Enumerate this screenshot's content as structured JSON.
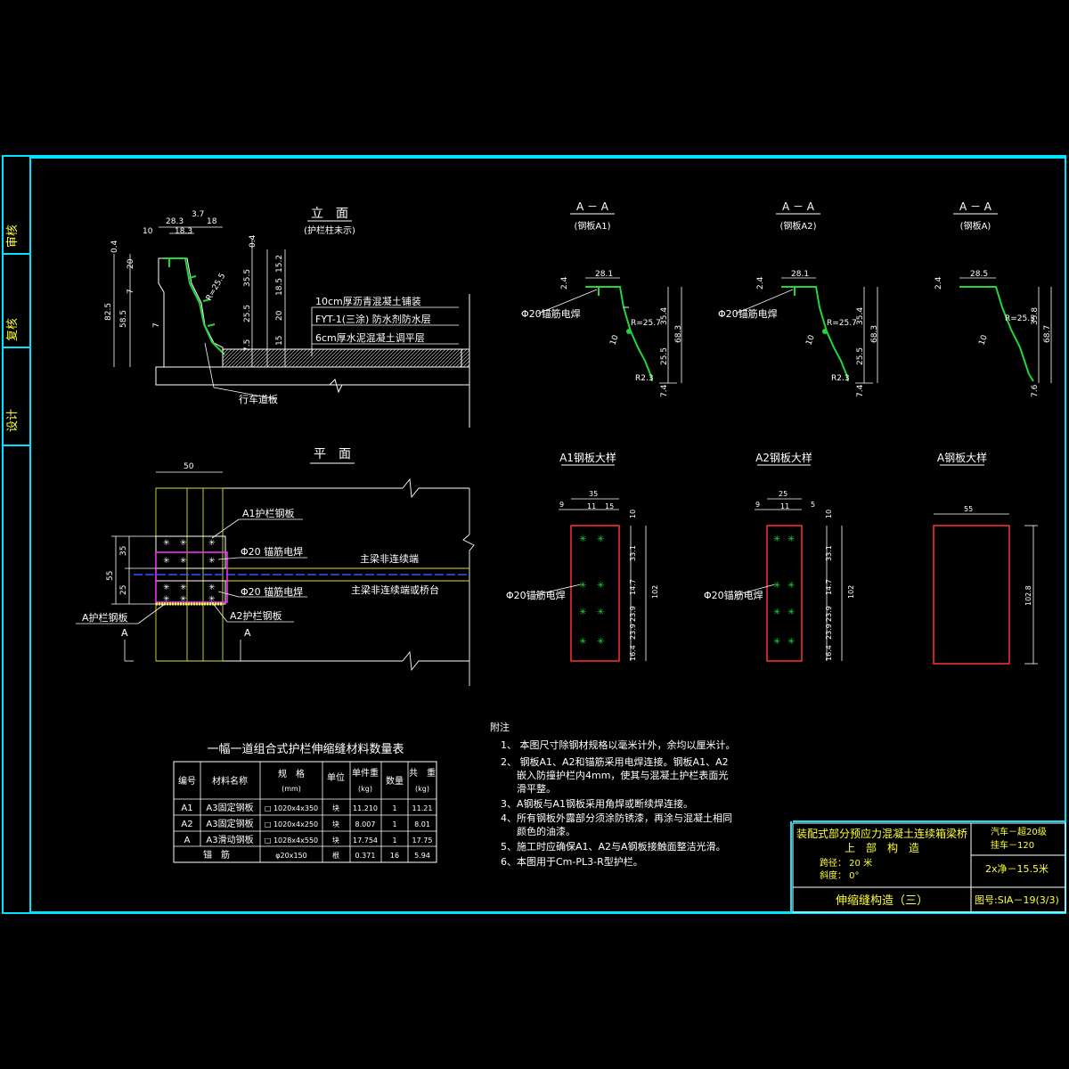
{
  "side_strip": {
    "review": "审核",
    "recheck": "复核",
    "design": "设计"
  },
  "elevation": {
    "title": "立　面",
    "subtitle": "(护栏柱未示)",
    "dims": {
      "d28_3": "28.3",
      "d3_7": "3.7",
      "d18": "18",
      "d10": "10",
      "d18_3": "18.3",
      "d0_4a": "0.4",
      "d20a": "20",
      "d7_3": "7",
      "d82_5": "82.5",
      "d58_5": "58.5",
      "d7": "7",
      "r25_5": "R=25.5",
      "d0_4b": "0.4",
      "d35_5": "35.5",
      "d15_2": "15.2",
      "d18_5": "18.5",
      "d25_5": "25.5",
      "d20b": "20",
      "d7_5": "7.5",
      "d15": "15"
    },
    "layers": [
      "10cm厚沥青混凝土铺装",
      "FYT-1(三涂) 防水剂防水层",
      "6cm厚水泥混凝土调平层"
    ],
    "deck_label": "行车道板"
  },
  "sections": [
    {
      "title": "A － A",
      "subtitle": "(钢板A1)",
      "weld": "Φ20锚筋电焊",
      "d28_1": "28.1",
      "d2_4": "2.4",
      "r": "R=25.7",
      "d35_4": "35.4",
      "d68_3": "68.3",
      "d10": "10",
      "d25_5": "25.5",
      "d7_4": "7.4",
      "r23": "R2.3"
    },
    {
      "title": "A － A",
      "subtitle": "(钢板A2)",
      "weld": "Φ20锚筋电焊",
      "d28_1": "28.1",
      "d2_4": "2.4",
      "r": "R=25.7",
      "d35_4": "35.4",
      "d68_3": "68.3",
      "d10": "10",
      "d25_5": "25.5",
      "d7_4": "7.4",
      "r23": "R2.3"
    },
    {
      "title": "A － A",
      "subtitle": "(钢板A)",
      "d28_5": "28.5",
      "d2_4": "2.4",
      "r": "R=25.3",
      "d35_8": "35.8",
      "d68_7": "68.7",
      "d10": "10",
      "d7_6": "7.6"
    }
  ],
  "plan": {
    "title": "平　面",
    "d50": "50",
    "d35": "35",
    "d55": "55",
    "d25": "25",
    "a1_label": "A1护栏钢板",
    "weld1": "Φ20  锚筋电焊",
    "weld2": "Φ20  锚筋电焊",
    "main_beam1": "主梁非连续端",
    "main_beam2": "主梁非连续端或桥台",
    "a_label": "A护栏钢板",
    "a2_label": "A2护栏钢板",
    "cut_a": "A"
  },
  "details": [
    {
      "title": "A1钢板大样",
      "top": [
        "9",
        "11",
        "15"
      ],
      "top_total": "35",
      "weld": "Φ20锚筋电焊",
      "side": [
        "10",
        "33.1",
        "14.7",
        "23.9",
        "23.9",
        "16.4"
      ],
      "total": "102"
    },
    {
      "title": "A2钢板大样",
      "top": [
        "9",
        "11",
        "5"
      ],
      "top_total": "25",
      "weld": "Φ20锚筋电焊",
      "side": [
        "10",
        "33.1",
        "14.7",
        "23.9",
        "23.9",
        "16.4"
      ],
      "total": "102"
    },
    {
      "title": "A钢板大样",
      "top_total": "55",
      "total": "102.8"
    }
  ],
  "table": {
    "title": "一幅一道组合式护栏伸缩缝材料数量表",
    "headers": [
      "编号",
      "材料名称",
      "规　格",
      "(mm)",
      "单位",
      "单件重",
      "(kg)",
      "数量",
      "共　重",
      "(kg)"
    ],
    "rows": [
      [
        "A1",
        "A3固定钢板",
        "□ 1020x4x350",
        "块",
        "11.210",
        "1",
        "11.21"
      ],
      [
        "A2",
        "A3固定钢板",
        "□ 1020x4x250",
        "块",
        "8.007",
        "1",
        "8.01"
      ],
      [
        "A",
        "A3滑动钢板",
        "□ 1028x4x550",
        "块",
        "17.754",
        "1",
        "17.75"
      ],
      [
        "",
        "锚　筋",
        "φ20x150",
        "根",
        "0.371",
        "16",
        "5.94"
      ]
    ]
  },
  "notes": {
    "title": "附注",
    "items": [
      "1、 本图尺寸除钢材规格以毫米计外，余均以厘米计。",
      "2、 钢板A1、A2和锚筋采用电焊连接。钢板A1、A2",
      "嵌入防撞护栏内4mm，使其与混凝土护栏表面光",
      "滑平整。",
      "3、A钢板与A1钢板采用角焊或断续焊连接。",
      "4、所有钢板外露部分须涂防锈漆，再涂与混凝土相同",
      "颜色的油漆。",
      "5、施工时应确保A1、A2与A钢板接触面整洁光滑。",
      "6、本图用于Cm-PL3-R型护栏。"
    ]
  },
  "title_block": {
    "project": "装配式部分预应力混凝土连续箱梁桥",
    "sub": "上　部　构　造",
    "span": "跨径： 20 米",
    "skew": "斜度： 0°",
    "load1": "汽车－超20级",
    "load2": "挂车－120",
    "width": "2x净－15.5米",
    "drawing_name": "伸缩缝构造（三）",
    "drawing_no": "图号:SIA－19(3/3)"
  },
  "colors": {
    "frame": "#00e5ff",
    "green": "#22d63a",
    "red": "#ff3333",
    "blue": "#3355ff",
    "magenta": "#ff33ff",
    "yellow": "#ffff33",
    "text": "#ffffff"
  }
}
